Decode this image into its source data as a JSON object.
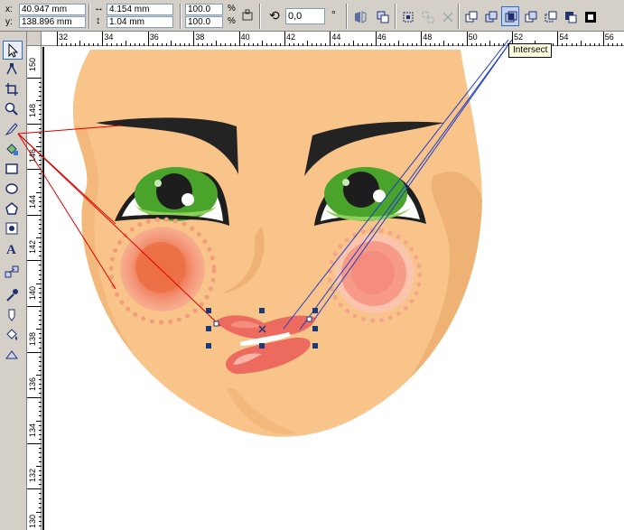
{
  "propbar": {
    "x_label": "x:",
    "x_value": "40.947 mm",
    "y_label": "y:",
    "y_value": "138.896 mm",
    "width_value": "4.154 mm",
    "height_value": "1.04 mm",
    "scale_x": "100.0",
    "scale_y": "100.0",
    "percent": "%",
    "rotation": "0,0",
    "degree": "°"
  },
  "tooltip": "Intersect",
  "rulers": {
    "h_numbers": [
      "32",
      "34",
      "36",
      "38",
      "40",
      "42",
      "44",
      "46",
      "48",
      "50",
      "52",
      "54",
      "56"
    ],
    "v_numbers": [
      "150",
      "148",
      "146",
      "144",
      "142",
      "140",
      "138",
      "136",
      "134",
      "132",
      "130"
    ]
  },
  "colors": {
    "skin": "#f8c48a",
    "skin_shadow": "#eeb274",
    "brow": "#232323",
    "iris": "#4aa32b",
    "blush": "#f07a55",
    "lips": "#ec6a5e",
    "selection": "#1a3a7a",
    "guide_red": "#dd0000",
    "guide_blue": "#1e3cc8"
  }
}
